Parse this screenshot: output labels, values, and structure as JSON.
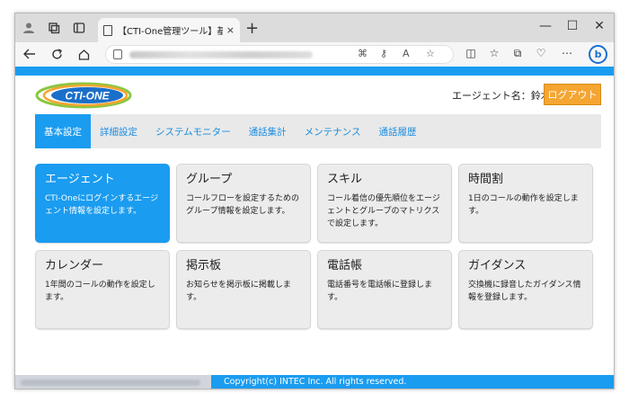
{
  "browser": {
    "tab_title": "【CTI-One管理ツール】基本設定",
    "tab_close": "×",
    "new_tab": "+",
    "minimize": "—",
    "maximize": "☐",
    "close": "✕",
    "bing_label": "b"
  },
  "header": {
    "logo_text": "CTI-ONE",
    "agent_label": "エージェント名：鈴木",
    "logout_label": "ログアウト"
  },
  "menu": {
    "items": [
      {
        "label": "基本設定",
        "active": true
      },
      {
        "label": "詳細設定",
        "active": false
      },
      {
        "label": "システムモニター",
        "active": false
      },
      {
        "label": "通話集計",
        "active": false
      },
      {
        "label": "メンテナンス",
        "active": false
      },
      {
        "label": "通話履歴",
        "active": false
      }
    ]
  },
  "cards": [
    {
      "title": "エージェント",
      "desc": "CTI-Oneにログインするエージェント情報を設定します。",
      "active": true
    },
    {
      "title": "グループ",
      "desc": "コールフローを設定するためのグループ情報を設定します。",
      "active": false
    },
    {
      "title": "スキル",
      "desc": "コール着信の優先順位をエージェントとグループのマトリクスで設定します。",
      "active": false
    },
    {
      "title": "時間割",
      "desc": "1日のコールの動作を設定します。",
      "active": false
    },
    {
      "title": "カレンダー",
      "desc": "1年間のコールの動作を設定します。",
      "active": false
    },
    {
      "title": "掲示板",
      "desc": "お知らせを掲示板に掲載します。",
      "active": false
    },
    {
      "title": "電話帳",
      "desc": "電話番号を電話帳に登録します。",
      "active": false
    },
    {
      "title": "ガイダンス",
      "desc": "交換機に録音したガイダンス情報を登録します。",
      "active": false
    }
  ],
  "footer": {
    "copyright": "Copyright(c) INTEC Inc. All rights reserved."
  },
  "colors": {
    "accent": "#1a9cf0",
    "logout": "#f5a531",
    "card_bg": "#ececec"
  }
}
